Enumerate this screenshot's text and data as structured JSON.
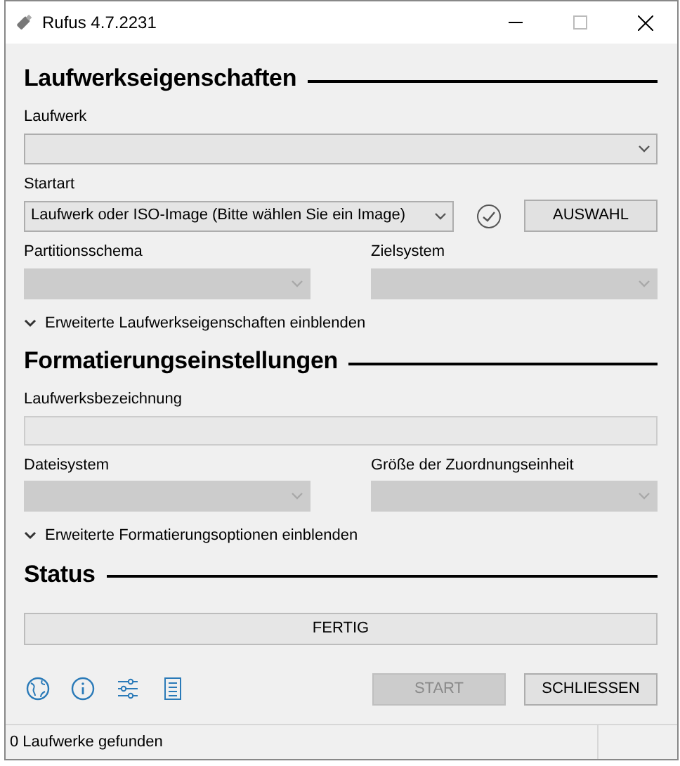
{
  "window": {
    "title": "Rufus 4.7.2231"
  },
  "drive_properties": {
    "heading": "Laufwerkseigenschaften",
    "device": {
      "label": "Laufwerk",
      "disabled": false
    },
    "boot_selection": {
      "label": "Startart",
      "value": "Laufwerk oder ISO-Image (Bitte wählen Sie ein Image)",
      "select_button": "AUSWAHL"
    },
    "partition_scheme": {
      "label": "Partitionsschema",
      "disabled": true
    },
    "target_system": {
      "label": "Zielsystem",
      "disabled": true
    },
    "advanced_toggle": {
      "label": "Erweiterte Laufwerkseigenschaften einblenden",
      "expanded": false
    }
  },
  "format_options": {
    "heading": "Formatierungseinstellungen",
    "volume_label": {
      "label": "Laufwerksbezeichnung",
      "disabled": true
    },
    "file_system": {
      "label": "Dateisystem",
      "disabled": true
    },
    "cluster_size": {
      "label": "Größe der Zuordnungseinheit",
      "disabled": true
    },
    "advanced_toggle": {
      "label": "Erweiterte Formatierungsoptionen einblenden",
      "expanded": false
    }
  },
  "status": {
    "heading": "Status",
    "progress_text": "FERTIG"
  },
  "buttons": [
    {
      "label": "START",
      "disabled": true
    },
    {
      "label": "SCHLIESSEN",
      "disabled": false
    }
  ],
  "status_bar": {
    "text": "0 Laufwerke gefunden"
  }
}
